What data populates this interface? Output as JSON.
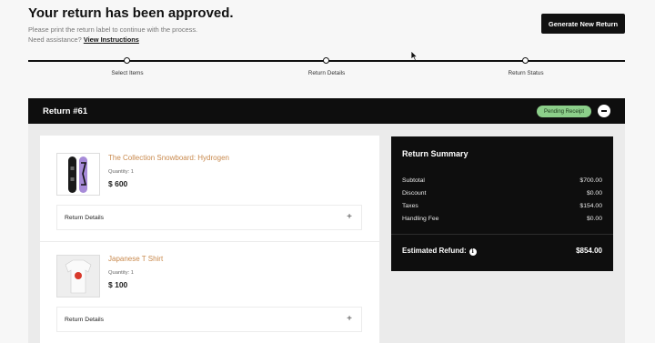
{
  "header": {
    "title": "Your return has been approved.",
    "instruction": "Please print the return label to continue with the process.",
    "assistance_prefix": "Need assistance?",
    "assistance_link": "View Instructions",
    "generate_button": "Generate New Return"
  },
  "progress": {
    "steps": [
      "Select Items",
      "Return Details",
      "Return Status"
    ]
  },
  "return": {
    "title": "Return #61",
    "status": "Pending Receipt",
    "status_color": "#8ccf8a"
  },
  "items": [
    {
      "name": "The Collection Snowboard: Hydrogen",
      "quantity": "Quantity: 1",
      "price": "$ 600",
      "details_label": "Return Details"
    },
    {
      "name": "Japanese T Shirt",
      "quantity": "Quantity: 1",
      "price": "$ 100",
      "details_label": "Return Details"
    }
  ],
  "summary": {
    "title": "Return Summary",
    "rows": [
      {
        "label": "Subtotal",
        "value": "$700.00"
      },
      {
        "label": "Discount",
        "value": "$0.00"
      },
      {
        "label": "Taxes",
        "value": "$154.00"
      },
      {
        "label": "Handling Fee",
        "value": "$0.00"
      }
    ],
    "refund_label": "Estimated Refund:",
    "refund_value": "$854.00"
  },
  "colors": {
    "accent": "#c98a4e",
    "dark": "#0e0e0e"
  }
}
